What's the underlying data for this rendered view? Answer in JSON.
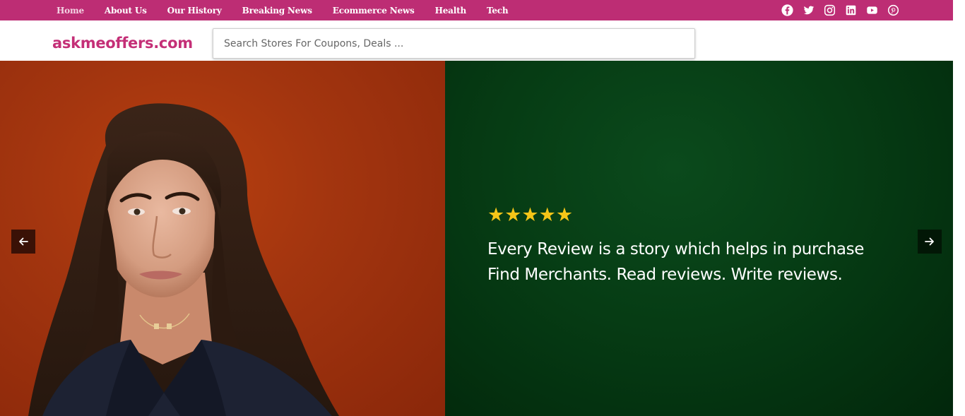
{
  "nav": {
    "items": [
      {
        "label": "Home"
      },
      {
        "label": "About Us"
      },
      {
        "label": "Our History"
      },
      {
        "label": "Breaking News"
      },
      {
        "label": "Ecommerce News"
      },
      {
        "label": "Health"
      },
      {
        "label": "Tech"
      }
    ],
    "social": [
      "facebook-icon",
      "twitter-icon",
      "instagram-icon",
      "linkedin-icon",
      "youtube-icon",
      "pinterest-icon"
    ]
  },
  "header": {
    "logo": "askmeoffers.com",
    "search_placeholder": "Search Stores For Coupons, Deals ..."
  },
  "hero": {
    "rating": 5,
    "stars": "★★★★★",
    "line1": "Every Review is a story which helps in purchase",
    "line2": "Find Merchants. Read reviews. Write reviews."
  },
  "colors": {
    "brand": "#bd2d74",
    "logo": "#c42f77",
    "hero_left": "#a3350f",
    "hero_right": "#063c14",
    "star": "#f5c518"
  }
}
